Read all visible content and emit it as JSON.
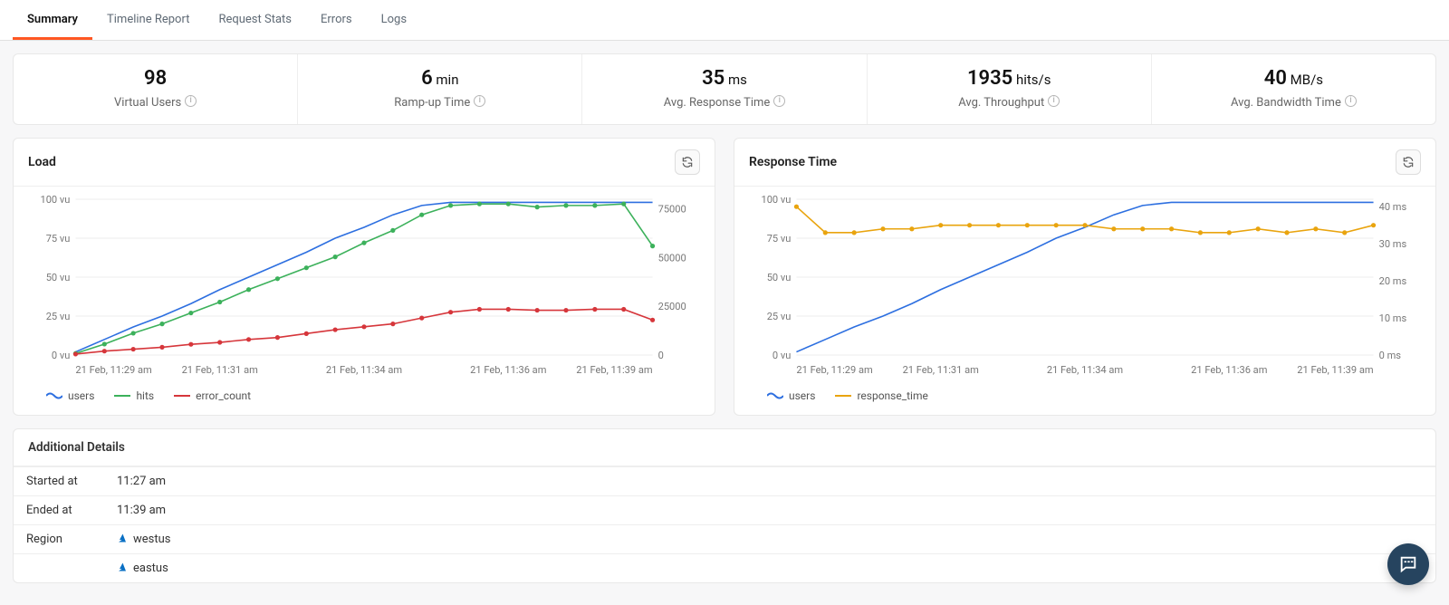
{
  "tabs": [
    "Summary",
    "Timeline Report",
    "Request Stats",
    "Errors",
    "Logs"
  ],
  "active_tab_index": 0,
  "kpis": [
    {
      "value": "98",
      "unit": "",
      "label": "Virtual Users"
    },
    {
      "value": "6",
      "unit": "min",
      "label": "Ramp-up Time"
    },
    {
      "value": "35",
      "unit": "ms",
      "label": "Avg. Response Time"
    },
    {
      "value": "1935",
      "unit": "hits/s",
      "label": "Avg. Throughput"
    },
    {
      "value": "40",
      "unit": "MB/s",
      "label": "Avg. Bandwidth Time"
    }
  ],
  "colors": {
    "users": "#2d6fe0",
    "hits": "#3cb15b",
    "error_count": "#d6363b",
    "response_time": "#e9a40e"
  },
  "load_chart_title": "Load",
  "response_chart_title": "Response Time",
  "legend_labels": {
    "users": "users",
    "hits": "hits",
    "error_count": "error_count",
    "response_time": "response_time"
  },
  "details": {
    "header": "Additional Details",
    "started_key": "Started at",
    "started_val": "11:27 am",
    "ended_key": "Ended at",
    "ended_val": "11:39 am",
    "region_key": "Region",
    "regions": [
      "westus",
      "eastus"
    ]
  },
  "chart_data": [
    {
      "type": "line",
      "title": "Load",
      "x_labels": [
        "21 Feb, 11:29 am",
        "21 Feb, 11:31 am",
        "21 Feb, 11:34 am",
        "21 Feb, 11:36 am",
        "21 Feb, 11:39 am"
      ],
      "y_left": {
        "label": "vu",
        "ticks": [
          0,
          25,
          50,
          75,
          100
        ],
        "range": [
          0,
          100
        ]
      },
      "y_right": {
        "label": "",
        "ticks": [
          0,
          25000,
          50000,
          75000
        ],
        "range": [
          0,
          80000
        ]
      },
      "x": [
        0,
        1,
        2,
        3,
        4,
        5,
        6,
        7,
        8,
        9,
        10,
        11,
        12,
        13,
        14,
        15,
        16,
        17,
        18,
        19,
        20
      ],
      "series": [
        {
          "name": "users",
          "axis": "left",
          "style": "line",
          "values": [
            2,
            10,
            18,
            25,
            33,
            42,
            50,
            58,
            66,
            75,
            82,
            90,
            96,
            98,
            98,
            98,
            98,
            98,
            98,
            98,
            98
          ]
        },
        {
          "name": "hits",
          "axis": "left",
          "style": "dots",
          "values": [
            1,
            7,
            14,
            20,
            27,
            34,
            42,
            49,
            56,
            63,
            72,
            80,
            90,
            96,
            97,
            97,
            95,
            96,
            96,
            97,
            70
          ]
        },
        {
          "name": "error_count",
          "axis": "right",
          "style": "dots",
          "values": [
            500,
            2000,
            3000,
            4000,
            5500,
            6500,
            8000,
            9000,
            11000,
            13000,
            14500,
            16000,
            19000,
            22000,
            23500,
            23500,
            23000,
            23000,
            23500,
            23500,
            18000
          ]
        }
      ]
    },
    {
      "type": "line",
      "title": "Response Time",
      "x_labels": [
        "21 Feb, 11:29 am",
        "21 Feb, 11:31 am",
        "21 Feb, 11:34 am",
        "21 Feb, 11:36 am",
        "21 Feb, 11:39 am"
      ],
      "y_left": {
        "label": "vu",
        "ticks": [
          0,
          25,
          50,
          75,
          100
        ],
        "range": [
          0,
          100
        ]
      },
      "y_right": {
        "label": "ms",
        "ticks": [
          0,
          10,
          20,
          30,
          40
        ],
        "range": [
          0,
          42
        ]
      },
      "x": [
        0,
        1,
        2,
        3,
        4,
        5,
        6,
        7,
        8,
        9,
        10,
        11,
        12,
        13,
        14,
        15,
        16,
        17,
        18,
        19,
        20
      ],
      "series": [
        {
          "name": "users",
          "axis": "left",
          "style": "line",
          "values": [
            2,
            10,
            18,
            25,
            33,
            42,
            50,
            58,
            66,
            75,
            82,
            90,
            96,
            98,
            98,
            98,
            98,
            98,
            98,
            98,
            98
          ]
        },
        {
          "name": "response_time",
          "axis": "right",
          "style": "dots",
          "values": [
            40,
            33,
            33,
            34,
            34,
            35,
            35,
            35,
            35,
            35,
            35,
            34,
            34,
            34,
            33,
            33,
            34,
            33,
            34,
            33,
            35
          ]
        }
      ]
    }
  ]
}
